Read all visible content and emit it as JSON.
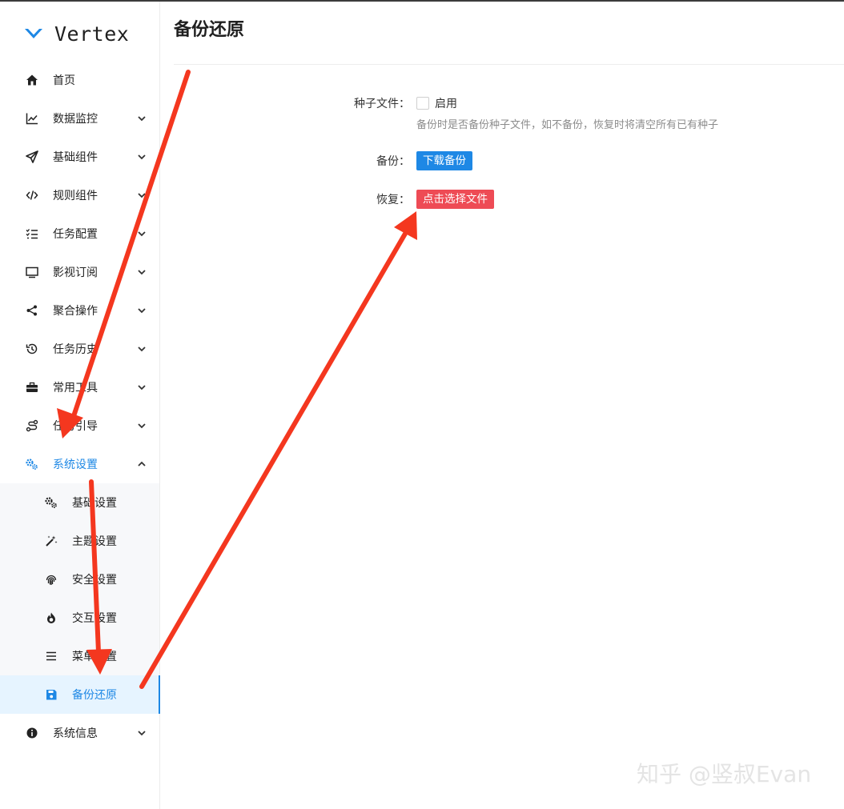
{
  "app": {
    "name": "Vertex",
    "accent_color": "#1e88e5",
    "logo_icon": "vertex-chevron-logo"
  },
  "sidebar": {
    "items": [
      {
        "label": "首页",
        "icon": "home-icon",
        "expandable": false
      },
      {
        "label": "数据监控",
        "icon": "line-chart-icon",
        "expandable": true
      },
      {
        "label": "基础组件",
        "icon": "paper-plane-icon",
        "expandable": true
      },
      {
        "label": "规则组件",
        "icon": "code-icon",
        "expandable": true
      },
      {
        "label": "任务配置",
        "icon": "checklist-icon",
        "expandable": true
      },
      {
        "label": "影视订阅",
        "icon": "monitor-icon",
        "expandable": true
      },
      {
        "label": "聚合操作",
        "icon": "share-nodes-icon",
        "expandable": true
      },
      {
        "label": "任务历史",
        "icon": "history-icon",
        "expandable": true
      },
      {
        "label": "常用工具",
        "icon": "toolbox-icon",
        "expandable": true
      },
      {
        "label": "任务引导",
        "icon": "route-icon",
        "expandable": true
      },
      {
        "label": "系统设置",
        "icon": "gears-icon",
        "expandable": true,
        "expanded": true
      },
      {
        "label": "系统信息",
        "icon": "info-icon",
        "expandable": true
      }
    ],
    "system_settings_children": [
      {
        "label": "基础设置",
        "icon": "gears-icon"
      },
      {
        "label": "主题设置",
        "icon": "magic-wand-icon"
      },
      {
        "label": "安全设置",
        "icon": "fingerprint-icon"
      },
      {
        "label": "交互设置",
        "icon": "fire-icon"
      },
      {
        "label": "菜单设置",
        "icon": "bars-icon"
      },
      {
        "label": "备份还原",
        "icon": "floppy-icon",
        "selected": true
      }
    ]
  },
  "main": {
    "title": "备份还原",
    "torrent_file": {
      "label": "种子文件：",
      "checkbox_label": "启用",
      "checked": false,
      "hint": "备份时是否备份种子文件，如不备份，恢复时将清空所有已有种子"
    },
    "backup": {
      "label": "备份：",
      "button_label": "下载备份",
      "button_color": "#1e88e5"
    },
    "restore": {
      "label": "恢复：",
      "button_label": "点击选择文件",
      "button_color": "#ee4b55"
    }
  },
  "annotations": {
    "arrow_color": "#f4371f"
  },
  "watermark": "知乎 @竖叔Evan"
}
